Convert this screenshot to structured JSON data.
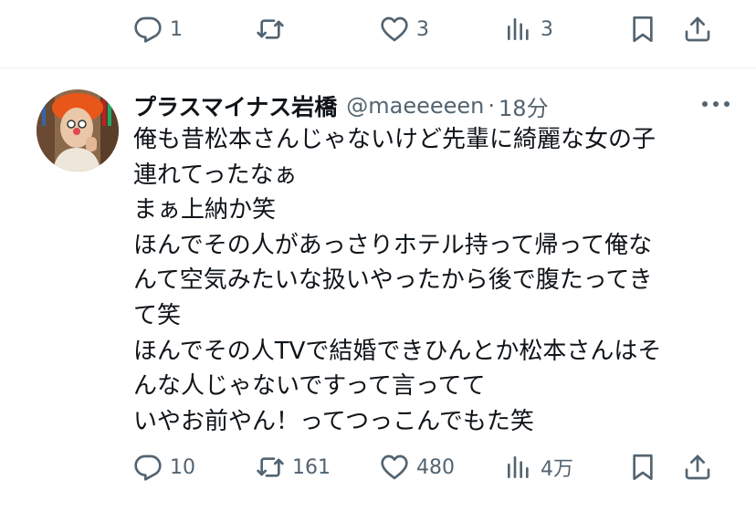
{
  "prev_tweet_actions": {
    "reply_count": "1",
    "retweet_count": "",
    "like_count": "3",
    "view_count": "3"
  },
  "tweet": {
    "display_name": "プラスマイナス岩橋",
    "handle": "@maeeeeen",
    "separator": "·",
    "time": "18分",
    "text_lines": [
      "俺も昔松本さんじゃないけど先輩に綺麗な女の子",
      "連れてったなぁ",
      "まぁ上納か笑",
      "ほんでその人があっさりホテル持って帰って俺な",
      "んて空気みたいな扱いやったから後で腹たってき",
      "て笑",
      "ほんでその人TVで結婚できひんとか松本さんはそ",
      "んな人じゃないですって言ってて",
      "いやお前やん！ってつっこんでもた笑"
    ],
    "actions": {
      "reply_count": "10",
      "retweet_count": "161",
      "like_count": "480",
      "view_count": "4万"
    }
  },
  "colors": {
    "text_primary": "#0f1419",
    "text_secondary": "#536471",
    "divider": "#eff3f4",
    "avatar_hair": "#e8561a"
  },
  "icons": [
    "reply-icon",
    "retweet-icon",
    "like-icon",
    "views-icon",
    "bookmark-icon",
    "share-icon",
    "more-icon"
  ]
}
